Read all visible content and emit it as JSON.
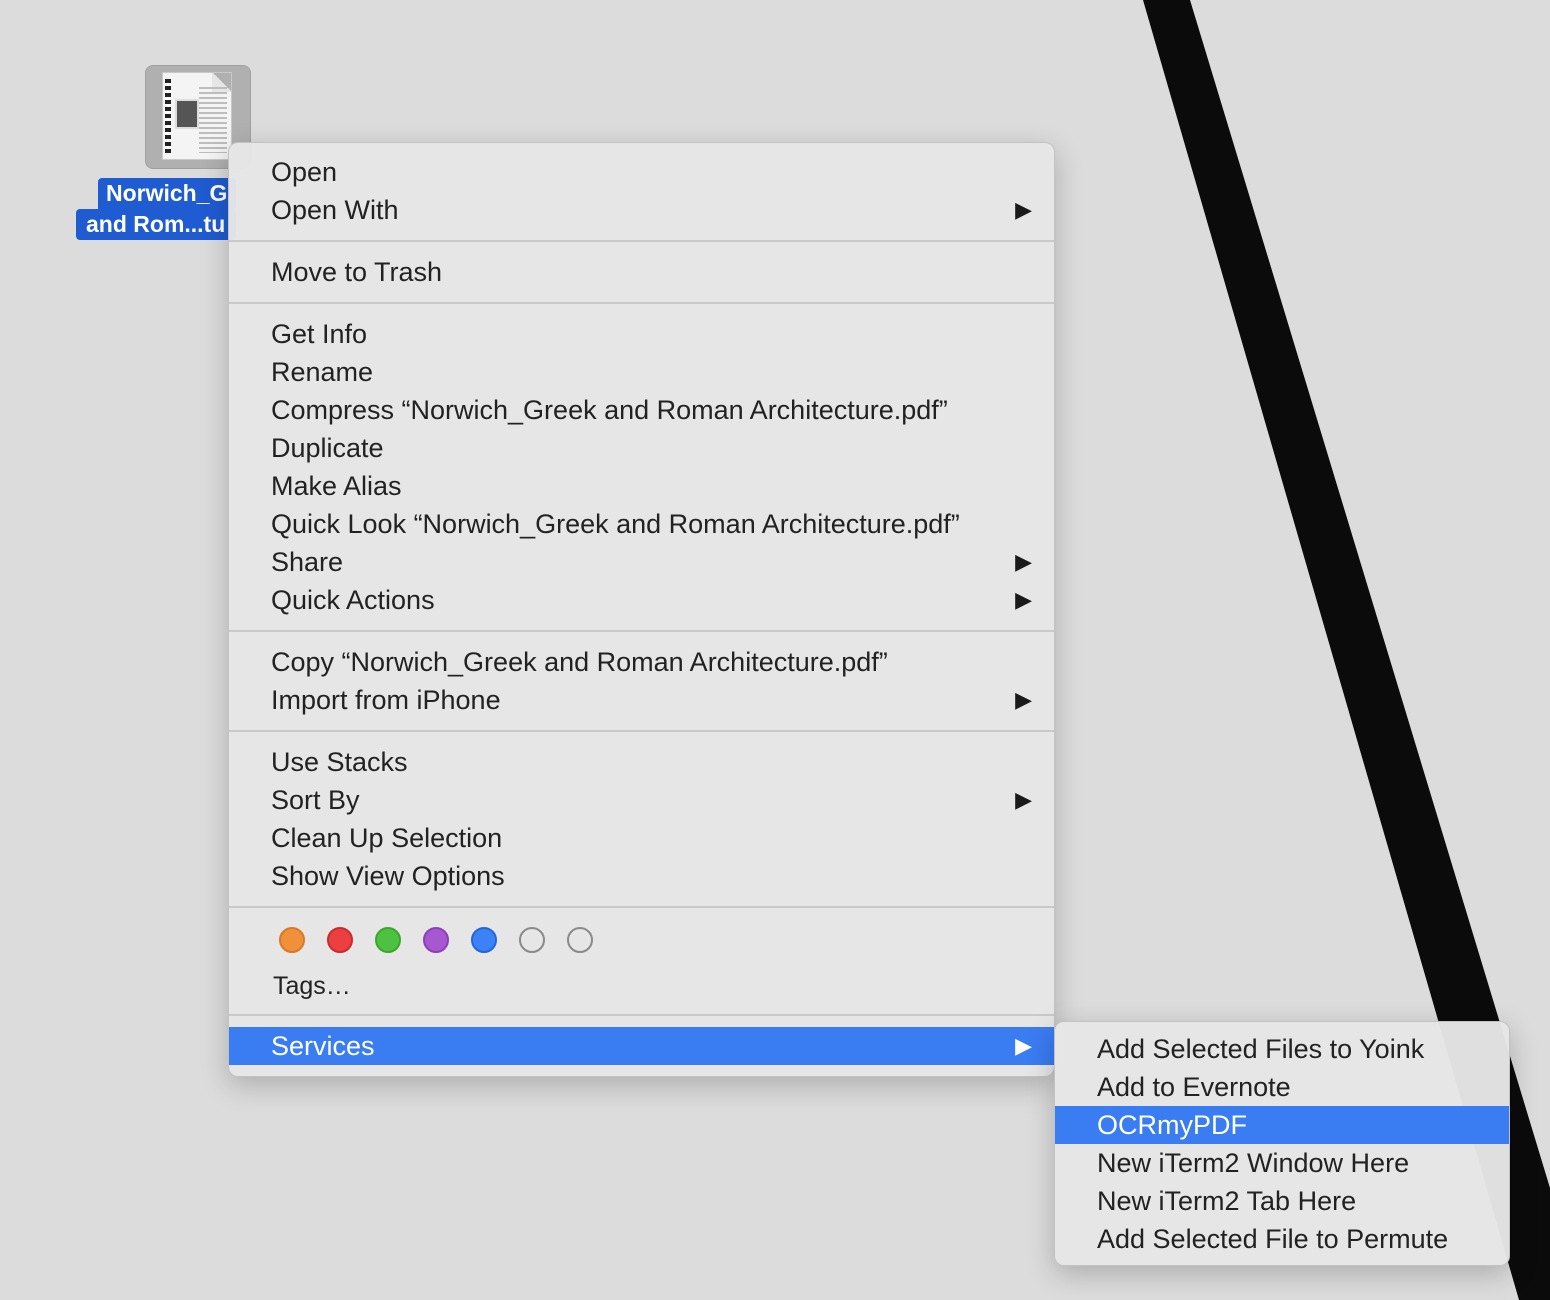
{
  "desktop_file": {
    "name_line1": "Norwich_G",
    "name_line2": "and Rom...tu"
  },
  "context_menu": {
    "groups": [
      [
        {
          "label": "Open",
          "submenu": false
        },
        {
          "label": "Open With",
          "submenu": true
        }
      ],
      [
        {
          "label": "Move to Trash",
          "submenu": false
        }
      ],
      [
        {
          "label": "Get Info",
          "submenu": false
        },
        {
          "label": "Rename",
          "submenu": false
        },
        {
          "label": "Compress “Norwich_Greek and Roman Architecture.pdf”",
          "submenu": false
        },
        {
          "label": "Duplicate",
          "submenu": false
        },
        {
          "label": "Make Alias",
          "submenu": false
        },
        {
          "label": "Quick Look “Norwich_Greek and Roman Architecture.pdf”",
          "submenu": false
        },
        {
          "label": "Share",
          "submenu": true
        },
        {
          "label": "Quick Actions",
          "submenu": true
        }
      ],
      [
        {
          "label": "Copy “Norwich_Greek and Roman Architecture.pdf”",
          "submenu": false
        },
        {
          "label": "Import from iPhone",
          "submenu": true
        }
      ],
      [
        {
          "label": "Use Stacks",
          "submenu": false
        },
        {
          "label": "Sort By",
          "submenu": true
        },
        {
          "label": "Clean Up Selection",
          "submenu": false
        },
        {
          "label": "Show View Options",
          "submenu": false
        }
      ]
    ],
    "tags": {
      "colors": [
        {
          "name": "orange",
          "fill": "#f0913a",
          "border": "#d9782a"
        },
        {
          "name": "red",
          "fill": "#ec3f40",
          "border": "#cc2a2b"
        },
        {
          "name": "green",
          "fill": "#4fc140",
          "border": "#3aa62e"
        },
        {
          "name": "purple",
          "fill": "#a757d0",
          "border": "#8d3fb6"
        },
        {
          "name": "blue",
          "fill": "#3b82f6",
          "border": "#2566d6"
        },
        {
          "name": "gray",
          "fill": "transparent",
          "border": "#8a8a8a"
        },
        {
          "name": "none",
          "fill": "transparent",
          "border": "#8a8a8a"
        }
      ],
      "label": "Tags…"
    },
    "services": {
      "label": "Services",
      "submenu": true,
      "selected": true
    }
  },
  "services_submenu": {
    "items": [
      {
        "label": "Add Selected Files to Yoink",
        "selected": false
      },
      {
        "label": "Add to Evernote",
        "selected": false
      },
      {
        "label": "OCRmyPDF",
        "selected": true
      },
      {
        "label": "New iTerm2 Window Here",
        "selected": false
      },
      {
        "label": "New iTerm2 Tab Here",
        "selected": false
      },
      {
        "label": "Add Selected File to Permute",
        "selected": false
      }
    ]
  },
  "symbols": {
    "submenu_arrow": "▶"
  },
  "colors": {
    "selection": "#3a7cf2",
    "desktop": "#dcdcdc",
    "menu_bg": "#e6e6e6"
  }
}
